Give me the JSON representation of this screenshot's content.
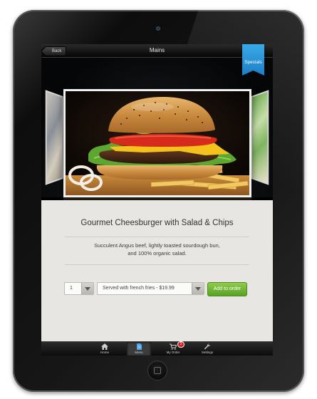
{
  "navbar": {
    "back_label": "Back",
    "title": "Mains",
    "specials_label": "Specials"
  },
  "gallery": {
    "main_image": "burger-photo",
    "left_image": "dish-photo",
    "right_image": "dish-photo"
  },
  "dish": {
    "title": "Gourmet Cheesburger with Salad & Chips",
    "description_line1": "Succulent Angus beef, lightly toasted sourdough bun,",
    "description_line2": "and 100% organic salad."
  },
  "order": {
    "quantity": "1",
    "option": "Served with french fries - $19.99",
    "add_label": "Add to order"
  },
  "tabs": [
    {
      "label": "Home",
      "icon": "home-icon"
    },
    {
      "label": "Menu",
      "icon": "document-icon"
    },
    {
      "label": "My Order",
      "icon": "cart-icon",
      "badge": "2"
    },
    {
      "label": "Settings",
      "icon": "wrench-icon"
    }
  ],
  "colors": {
    "accent_blue": "#2a93d8",
    "add_green": "#6db533",
    "badge_red": "#d21f1f",
    "panel_bg": "#e8e6e2"
  }
}
